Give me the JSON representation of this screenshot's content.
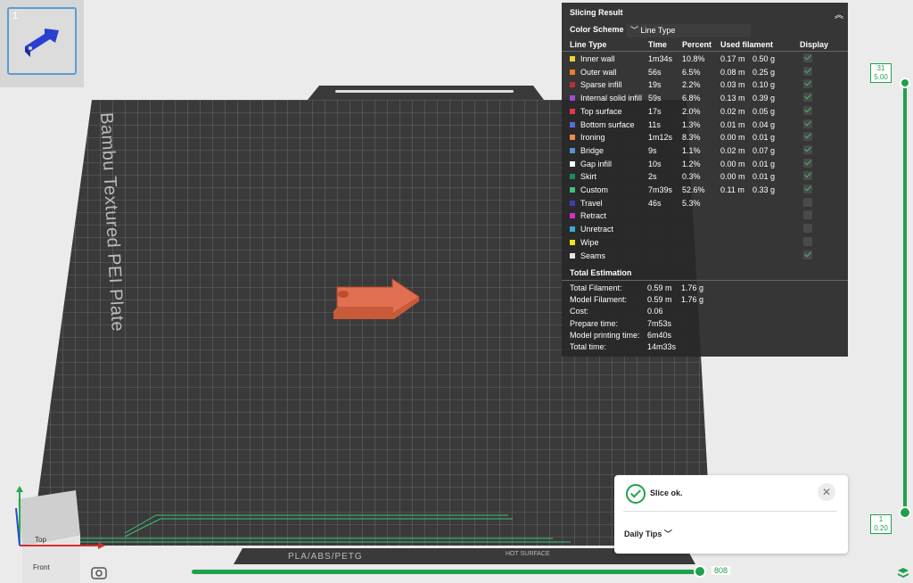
{
  "plate": {
    "number": "1",
    "name": "Bambu Textured PEI Plate",
    "filament_tag": "PLA/ABS/PETG",
    "surface_tag": "HOT SURFACE"
  },
  "panel": {
    "title": "Slicing Result",
    "color_scheme_label": "Color Scheme",
    "color_scheme_value": "Line Type",
    "headers": {
      "line_type": "Line Type",
      "time": "Time",
      "percent": "Percent",
      "used_filament": "Used filament",
      "display": "Display"
    },
    "rows": [
      {
        "color": "#f2d230",
        "name": "Inner wall",
        "time": "1m34s",
        "percent": "10.8%",
        "len": "0.17 m",
        "weight": "0.50 g",
        "on": true
      },
      {
        "color": "#f07830",
        "name": "Outer wall",
        "time": "56s",
        "percent": "6.5%",
        "len": "0.08 m",
        "weight": "0.25 g",
        "on": true
      },
      {
        "color": "#b93030",
        "name": "Sparse infill",
        "time": "19s",
        "percent": "2.2%",
        "len": "0.03 m",
        "weight": "0.10 g",
        "on": true
      },
      {
        "color": "#9b4fd0",
        "name": "Internal solid infill",
        "time": "59s",
        "percent": "6.8%",
        "len": "0.13 m",
        "weight": "0.39 g",
        "on": true
      },
      {
        "color": "#e8354a",
        "name": "Top surface",
        "time": "17s",
        "percent": "2.0%",
        "len": "0.02 m",
        "weight": "0.05 g",
        "on": true
      },
      {
        "color": "#5a6bd6",
        "name": "Bottom surface",
        "time": "11s",
        "percent": "1.3%",
        "len": "0.01 m",
        "weight": "0.04 g",
        "on": true
      },
      {
        "color": "#f08850",
        "name": "Ironing",
        "time": "1m12s",
        "percent": "8.3%",
        "len": "0.00 m",
        "weight": "0.01 g",
        "on": true
      },
      {
        "color": "#5b8fd0",
        "name": "Bridge",
        "time": "9s",
        "percent": "1.1%",
        "len": "0.02 m",
        "weight": "0.07 g",
        "on": true
      },
      {
        "color": "#ffffff",
        "name": "Gap infill",
        "time": "10s",
        "percent": "1.2%",
        "len": "0.00 m",
        "weight": "0.01 g",
        "on": true
      },
      {
        "color": "#1a8a5a",
        "name": "Skirt",
        "time": "2s",
        "percent": "0.3%",
        "len": "0.00 m",
        "weight": "0.01 g",
        "on": true
      },
      {
        "color": "#3cc27a",
        "name": "Custom",
        "time": "7m39s",
        "percent": "52.6%",
        "len": "0.11 m",
        "weight": "0.33 g",
        "on": true
      },
      {
        "color": "#3a3fb0",
        "name": "Travel",
        "time": "46s",
        "percent": "5.3%",
        "len": "",
        "weight": "",
        "on": false
      },
      {
        "color": "#d030c8",
        "name": "Retract",
        "time": "",
        "percent": "",
        "len": "",
        "weight": "",
        "on": false
      },
      {
        "color": "#3aa8d8",
        "name": "Unretract",
        "time": "",
        "percent": "",
        "len": "",
        "weight": "",
        "on": false
      },
      {
        "color": "#f4e61a",
        "name": "Wipe",
        "time": "",
        "percent": "",
        "len": "",
        "weight": "",
        "on": false
      },
      {
        "color": "#e6e6e6",
        "name": "Seams",
        "time": "",
        "percent": "",
        "len": "",
        "weight": "",
        "on": true
      }
    ],
    "estimation_title": "Total Estimation",
    "estimation": [
      {
        "label": "Total Filament:",
        "v1": "0.59 m",
        "v2": "1.76 g"
      },
      {
        "label": "Model Filament:",
        "v1": "0.59 m",
        "v2": "1.76 g"
      },
      {
        "label": "Cost:",
        "v1": "0.06",
        "v2": ""
      },
      {
        "label": "Prepare time:",
        "v1": "7m53s",
        "v2": ""
      },
      {
        "label": "Model printing time:",
        "v1": "6m40s",
        "v2": ""
      },
      {
        "label": "Total time:",
        "v1": "14m33s",
        "v2": ""
      }
    ]
  },
  "layer_slider": {
    "top_layer": "31",
    "top_height": "5.00",
    "bottom_layer": "1",
    "bottom_height": "0.20"
  },
  "move_slider": {
    "value": "808"
  },
  "toast": {
    "message": "Slice ok.",
    "tips": "Daily Tips"
  },
  "view_cube": {
    "top": "Top",
    "front": "Front"
  }
}
